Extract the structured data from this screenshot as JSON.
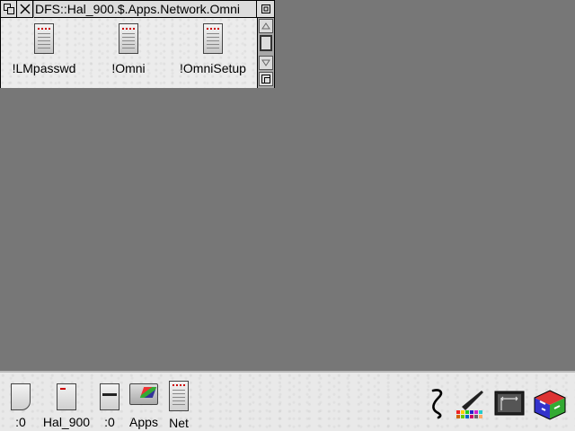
{
  "window": {
    "title": "DFS::Hal_900.$.Apps.Network.Omni",
    "files": [
      {
        "name": "!LMpasswd",
        "icon": "application-icon"
      },
      {
        "name": "!Omni",
        "icon": "application-icon"
      },
      {
        "name": "!OmniSetup",
        "icon": "application-icon"
      }
    ]
  },
  "iconbar": {
    "left": [
      {
        "label": ":0",
        "icon": "cdrom-drive-icon"
      },
      {
        "label": "Hal_900",
        "icon": "hard-disc-icon"
      },
      {
        "label": ":0",
        "icon": "floppy-drive-icon"
      },
      {
        "label": "Apps",
        "icon": "apps-folder-icon"
      },
      {
        "label": "Net",
        "icon": "network-icon"
      }
    ],
    "right": [
      {
        "icon": "task-manager-icon"
      },
      {
        "icon": "paint-palette-icon"
      },
      {
        "icon": "display-resolution-icon"
      },
      {
        "icon": "riscos-cube-icon"
      }
    ]
  },
  "colors": {
    "desktop": "#777777",
    "window_work": "#ececec",
    "iconbar": "#e9e9e9"
  }
}
